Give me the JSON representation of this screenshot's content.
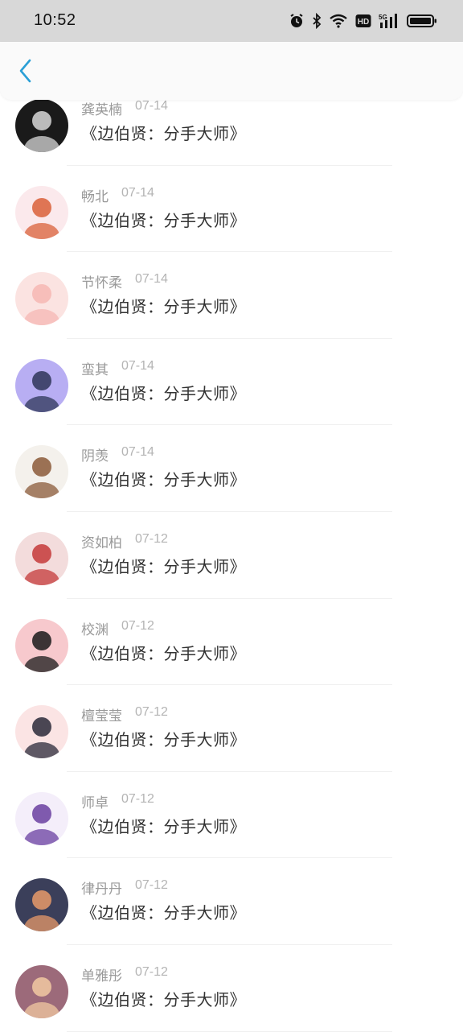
{
  "status_bar": {
    "time": "10:52",
    "icons": [
      "alarm-icon",
      "bluetooth-icon",
      "wifi-icon",
      "hd-icon",
      "5g-signal-icon",
      "battery-icon"
    ]
  },
  "nav": {
    "back_icon": "chevron-left-icon",
    "accent": "#2a9fd6"
  },
  "comments": [
    {
      "name": "龚英楠",
      "date": "07-14",
      "text": "《边伯贤：分手大师》",
      "avatar_colors": [
        "#1a1a1a",
        "#d8d8d8"
      ]
    },
    {
      "name": "畅北",
      "date": "07-14",
      "text": "《边伯贤：分手大师》",
      "avatar_colors": [
        "#fbe9ec",
        "#d9603a"
      ]
    },
    {
      "name": "节怀柔",
      "date": "07-14",
      "text": "《边伯贤：分手大师》",
      "avatar_colors": [
        "#fbe3e1",
        "#f6b7b3"
      ]
    },
    {
      "name": "蛮其",
      "date": "07-14",
      "text": "《边伯贤：分手大师》",
      "avatar_colors": [
        "#b8aef3",
        "#2e3558"
      ]
    },
    {
      "name": "阴羡",
      "date": "07-14",
      "text": "《边伯贤：分手大师》",
      "avatar_colors": [
        "#f4f1ec",
        "#8b5a3a"
      ]
    },
    {
      "name": "资如柏",
      "date": "07-12",
      "text": "《边伯贤：分手大师》",
      "avatar_colors": [
        "#f3dcdc",
        "#c43a3a"
      ]
    },
    {
      "name": "校渊",
      "date": "07-12",
      "text": "《边伯贤：分手大师》",
      "avatar_colors": [
        "#f7c9cd",
        "#1a1a1a"
      ]
    },
    {
      "name": "檀莹莹",
      "date": "07-12",
      "text": "《边伯贤：分手大师》",
      "avatar_colors": [
        "#fbe4e4",
        "#2a2a3a"
      ]
    },
    {
      "name": "师卓",
      "date": "07-12",
      "text": "《边伯贤：分手大师》",
      "avatar_colors": [
        "#f4eefa",
        "#6a3fa0"
      ]
    },
    {
      "name": "律丹丹",
      "date": "07-12",
      "text": "《边伯贤：分手大师》",
      "avatar_colors": [
        "#3b3f5a",
        "#e79a6a"
      ]
    },
    {
      "name": "单雅彤",
      "date": "07-12",
      "text": "《边伯贤：分手大师》",
      "avatar_colors": [
        "#9c6a7a",
        "#f2c9a2"
      ]
    }
  ]
}
